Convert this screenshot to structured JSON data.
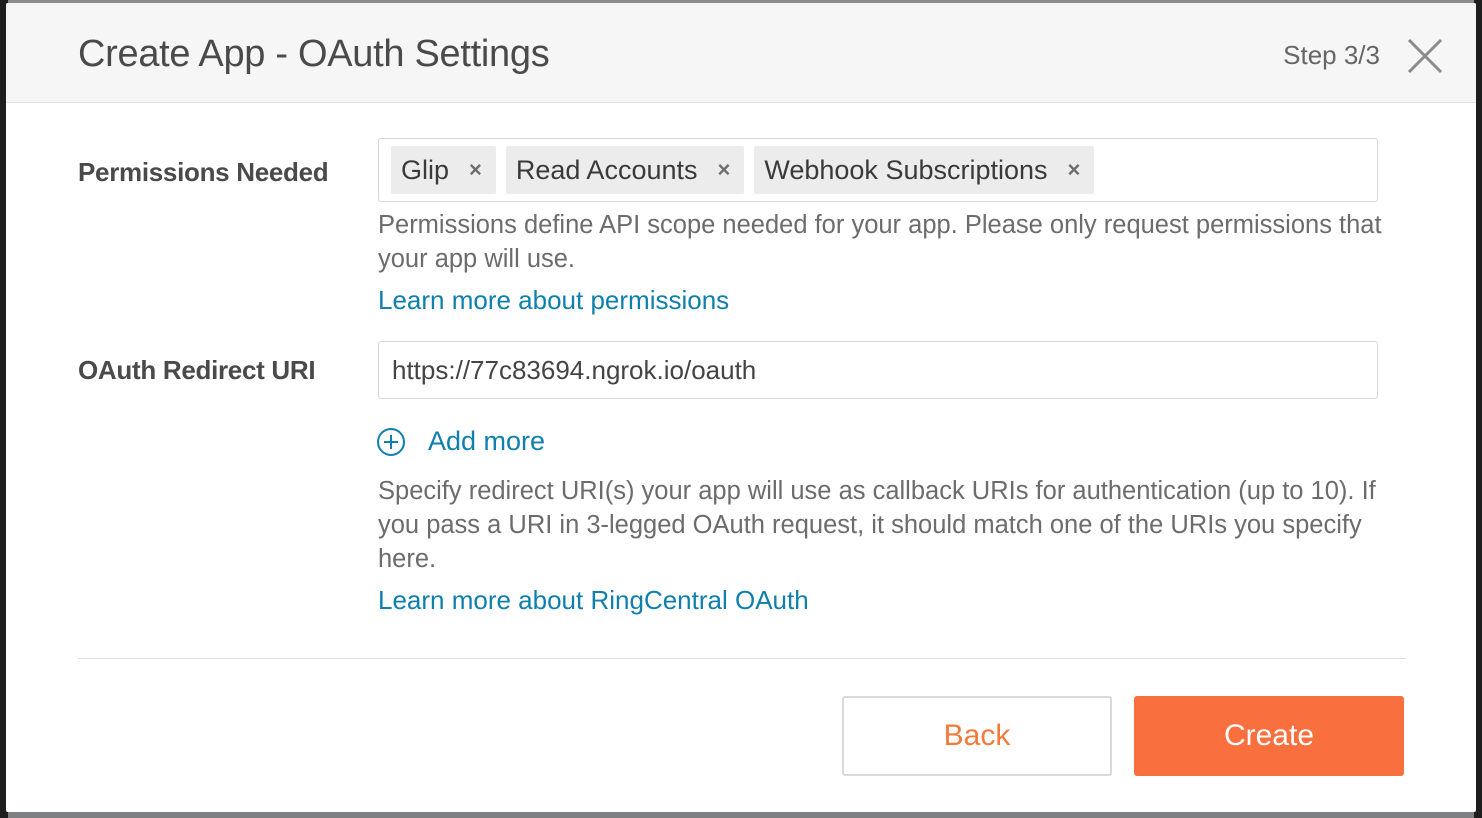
{
  "dialog": {
    "title": "Create App - OAuth Settings",
    "step": "Step 3/3",
    "close_icon": "close-icon"
  },
  "permissions": {
    "label": "Permissions Needed",
    "tags": [
      {
        "label": "Glip",
        "remove_icon": "×"
      },
      {
        "label": "Read Accounts",
        "remove_icon": "×"
      },
      {
        "label": "Webhook Subscriptions",
        "remove_icon": "×"
      }
    ],
    "help": "Permissions define API scope needed for your app. Please only request permissions that your app will use.",
    "learn_more": "Learn more about permissions"
  },
  "redirect": {
    "label": "OAuth Redirect URI",
    "value": "https://77c83694.ngrok.io/oauth",
    "add_more": "Add more",
    "help": "Specify redirect URI(s) your app will use as callback URIs for authentication (up to 10). If you pass a URI in 3-legged OAuth request, it should match one of the URIs you specify here.",
    "learn_more": "Learn more about RingCentral OAuth"
  },
  "footer": {
    "back_label": "Back",
    "create_label": "Create"
  },
  "colors": {
    "accent": "#f96f3e",
    "link": "#0f7fae"
  }
}
